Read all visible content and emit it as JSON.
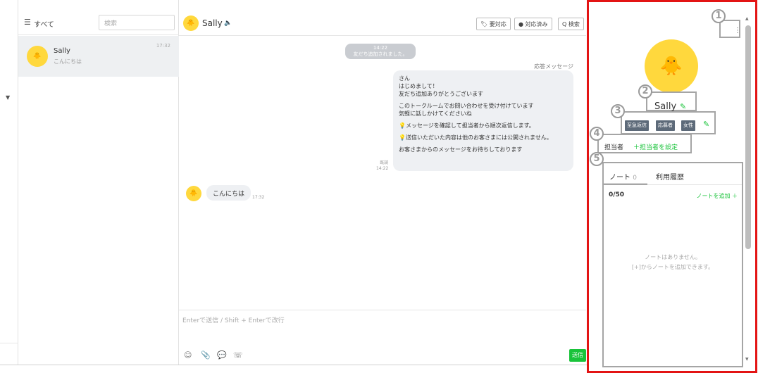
{
  "chat_list": {
    "filter_label": "すべて",
    "search_placeholder": "検索",
    "items": [
      {
        "name": "Sally",
        "preview": "こんにちは",
        "time": "17:32"
      }
    ]
  },
  "chat": {
    "title": "Sally",
    "buttons": {
      "needs_action": "要対応",
      "done": "対応済み",
      "search": "Q 検索"
    },
    "system_message": {
      "time": "14:22",
      "text": "友だち追加されました。"
    },
    "auto_reply_label": "応答メッセージ",
    "auto_reply_lines": [
      "さん",
      "はじめまして！",
      "友だち追加ありがとうございます",
      "",
      "このトークルームでお問い合わせを受け付けています",
      "気軽に話しかけてくださいね",
      "",
      "メッセージを確認して担当者から順次返信します。",
      "",
      "送信いただいた内容は他のお客さまには公開されません。",
      "",
      "お客さまからのメッセージをお待ちしております"
    ],
    "read_status": "既読",
    "auto_reply_time": "14:22",
    "incoming": {
      "text": "こんにちは",
      "time": "17:32"
    },
    "composer_placeholder": "Enterで送信 / Shift + Enterで改行",
    "send_label": "送信"
  },
  "profile": {
    "name": "Sally",
    "tags": [
      "至急返信",
      "応募者",
      "女性"
    ],
    "assignee_label": "担当者",
    "assign_link": "＋担当者を設定",
    "tabs": {
      "notes": "ノート",
      "notes_count": "0",
      "history": "利用履歴"
    },
    "note_counter": "0/50",
    "add_note": "ノートを追加 ＋",
    "empty_line1": "ノートはありません。",
    "empty_line2": "[+]からノートを追加できます。",
    "callouts": [
      "1",
      "2",
      "3",
      "4",
      "5"
    ]
  },
  "icons": {
    "menu": "menu-icon",
    "speaker": "speaker-icon",
    "kebab": "more-vertical-icon",
    "pencil": "pencil-icon",
    "emoji": "emoji-icon",
    "attach": "paperclip-icon",
    "bubble": "chat-bubble-icon",
    "phone": "phone-icon"
  },
  "colors": {
    "accent_green": "#19c33a",
    "highlight_red": "#e31414",
    "tag_bg": "#5d6a79",
    "avatar_yellow": "#ffd83d"
  }
}
